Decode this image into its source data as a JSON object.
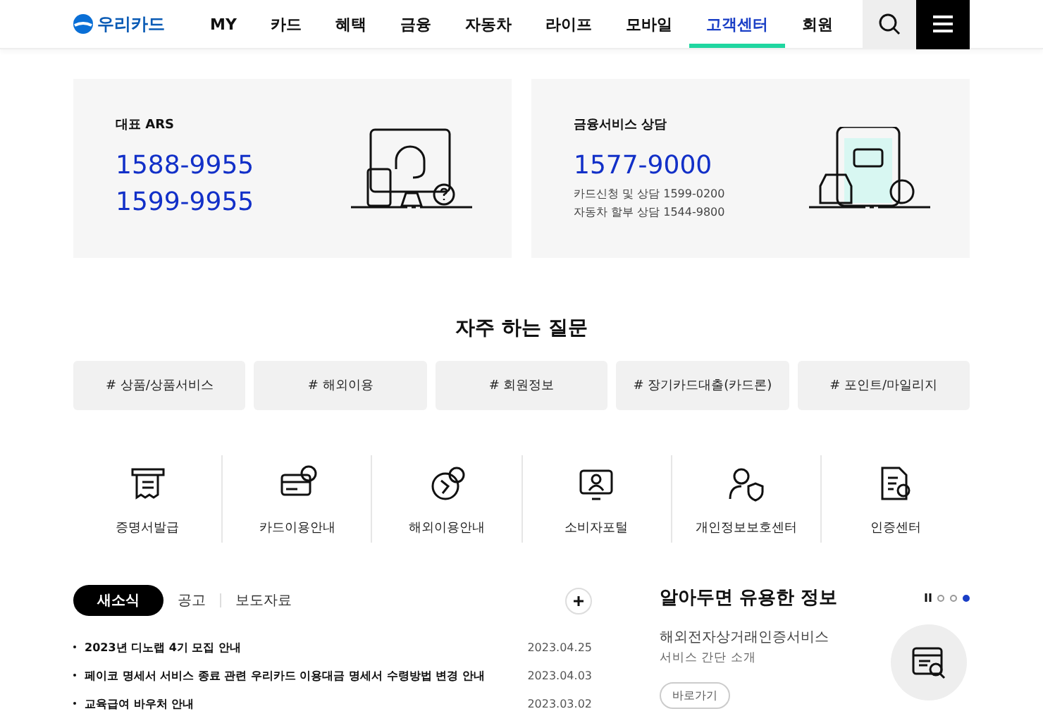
{
  "header": {
    "logo": "우리카드",
    "nav": [
      {
        "label": "MY",
        "selected": false
      },
      {
        "label": "카드",
        "selected": false
      },
      {
        "label": "혜택",
        "selected": false
      },
      {
        "label": "금융",
        "selected": false
      },
      {
        "label": "자동차",
        "selected": false
      },
      {
        "label": "라이프",
        "selected": false
      },
      {
        "label": "모바일",
        "selected": false
      },
      {
        "label": "고객센터",
        "selected": true
      },
      {
        "label": "회원",
        "selected": false
      }
    ]
  },
  "contact_cards": [
    {
      "kind": "ars",
      "title": "대표 ARS",
      "numbers": [
        "1588-9955",
        "1599-9955"
      ]
    },
    {
      "kind": "finance",
      "title": "금융서비스 상담",
      "numbers": [
        "1577-9000"
      ],
      "details": [
        "카드신청 및 상담 1599-0200",
        "자동차 할부 상담 1544-9800"
      ]
    }
  ],
  "faq": {
    "title": "자주 하는 질문",
    "tags": [
      "# 상품/상품서비스",
      "# 해외이용",
      "# 회원정보",
      "# 장기카드대출(카드론)",
      "# 포인트/마일리지"
    ]
  },
  "quick_links": [
    {
      "kind": "receipt",
      "label": "증명서발급"
    },
    {
      "kind": "card",
      "label": "카드이용안내"
    },
    {
      "kind": "globe",
      "label": "해외이용안내"
    },
    {
      "kind": "monitor",
      "label": "소비자포털"
    },
    {
      "kind": "shield",
      "label": "개인정보보호센터"
    },
    {
      "kind": "certificate",
      "label": "인증센터"
    }
  ],
  "news": {
    "tabs": [
      {
        "label": "새소식",
        "selected": true
      },
      {
        "label": "공고",
        "selected": false
      },
      {
        "label": "보도자료",
        "selected": false
      }
    ],
    "items": [
      {
        "title": "2023년 디노랩 4기 모집 안내",
        "date": "2023.04.25"
      },
      {
        "title": "페이코 명세서 서비스 종료 관련 우리카드 이용대금 명세서 수령방법 변경 안내",
        "date": "2023.04.03"
      },
      {
        "title": "교육급여 바우처 안내",
        "date": "2023.03.02"
      }
    ]
  },
  "info": {
    "title": "알아두면 유용한 정보",
    "dots": [
      {
        "selected": false
      },
      {
        "selected": false
      },
      {
        "selected": true
      }
    ],
    "item_title": "해외전자상거래인증서비스",
    "item_subtitle": "서비스 간단 소개",
    "button": "바로가기"
  }
}
